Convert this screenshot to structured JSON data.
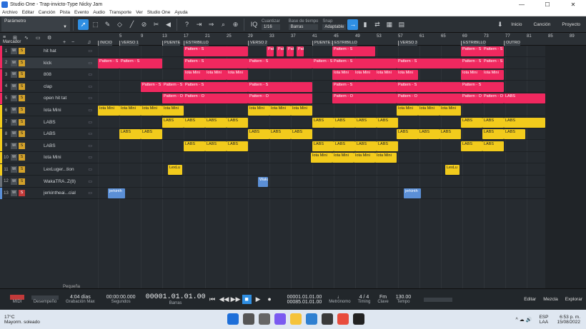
{
  "window": {
    "title": "Studio One - Trap-invicto-Type Nicky Jam"
  },
  "menu": [
    "Archivo",
    "Editar",
    "Canción",
    "Pista",
    "Evento",
    "Audio",
    "Transporte",
    "Ver",
    "Studio One",
    "Ayuda"
  ],
  "toolbar": {
    "parameter_label": "Parámetro",
    "quantize_label": "Cuantizar",
    "quantize_value": "1/16",
    "timebase_label": "Base de tiempo",
    "timebase_value": "Barras",
    "snap_label": "Snap",
    "snap_value": "Adaptable",
    "iq_label": "IQ",
    "right_buttons": [
      "Inicio",
      "Canción",
      "Proyecto"
    ]
  },
  "track_header": {
    "marker_label": "Marcador"
  },
  "tracks": [
    {
      "num": "1",
      "name": "hit hat",
      "color": "#f0285f",
      "solo_red": false
    },
    {
      "num": "2",
      "name": "kick",
      "color": "#f0285f",
      "solo_red": false
    },
    {
      "num": "3",
      "name": "808",
      "color": "#f0285f",
      "solo_red": false
    },
    {
      "num": "4",
      "name": "clap",
      "color": "#f0285f",
      "solo_red": false
    },
    {
      "num": "5",
      "name": "open hit tat",
      "color": "#f0285f",
      "solo_red": false
    },
    {
      "num": "6",
      "name": "Iota Mini",
      "color": "#f2cb1c",
      "solo_red": false
    },
    {
      "num": "7",
      "name": "LABS",
      "color": "#f2cb1c",
      "solo_red": false
    },
    {
      "num": "8",
      "name": "LABS",
      "color": "#f2cb1c",
      "solo_red": false
    },
    {
      "num": "9",
      "name": "LABS",
      "color": "#f2cb1c",
      "solo_red": false
    },
    {
      "num": "10",
      "name": "Iota Mini",
      "color": "#f2cb1c",
      "solo_red": false
    },
    {
      "num": "11",
      "name": "LexLuger...tion",
      "color": "#f2cb1c",
      "solo_red": false
    },
    {
      "num": "12",
      "name": "WakaTRA..Z(8)",
      "color": "#6a7077",
      "solo_red": false
    },
    {
      "num": "13",
      "name": "jerkintheai...cial",
      "color": "#5b8fd6",
      "solo_red": true
    }
  ],
  "ruler": {
    "ticks": [
      "5",
      "9",
      "13",
      "17",
      "21",
      "25",
      "29",
      "33",
      "37",
      "41",
      "45",
      "49",
      "53",
      "57",
      "61",
      "65",
      "69",
      "73",
      "77",
      "81",
      "85",
      "89"
    ],
    "markers": [
      "INICIO",
      "VERSO 1",
      "PUENTE",
      "ESTRIBILLO",
      "VERSO 2",
      "PUENTE 2",
      "ESTRIBILLO",
      "VERSO 3",
      "ESTRIBILLO",
      "OUTRO"
    ]
  },
  "clip_labels": {
    "pattern_s": "Pattern - S",
    "pattern_o": "Pattern - O",
    "iota": "Iota Mini",
    "labs": "LABS",
    "lex": "LexLu",
    "waka": "Waka",
    "jerk": "jerkinth"
  },
  "transport": {
    "midi_label": "MIDI",
    "perf_label": "Desempeño",
    "rec_time": "4:04 días",
    "rec_label": "Grabación Max",
    "seconds": "00:00:00.000",
    "seconds_label": "Segundos",
    "bars": "00001.01.01.00",
    "bars_label": "Barras",
    "loop_l": "00001.01.01.00",
    "loop_r": "00085.01.01.00",
    "metronome_label": "Metrónomo",
    "timing_value": "4 / 4",
    "timing_label": "Timing",
    "key_value": "Fm",
    "key_label": "Clave",
    "tempo_value": "130.00",
    "tempo_label": "Tempo",
    "right_buttons": [
      "Editar",
      "Mezcla",
      "Explorar"
    ],
    "size_label": "Pequeña"
  },
  "taskbar": {
    "temp": "17°C",
    "weather": "Mayorm. soleado",
    "lang": "ESP",
    "lang_sub": "LAA",
    "time": "6:53 p. m.",
    "date": "15/08/2022"
  }
}
